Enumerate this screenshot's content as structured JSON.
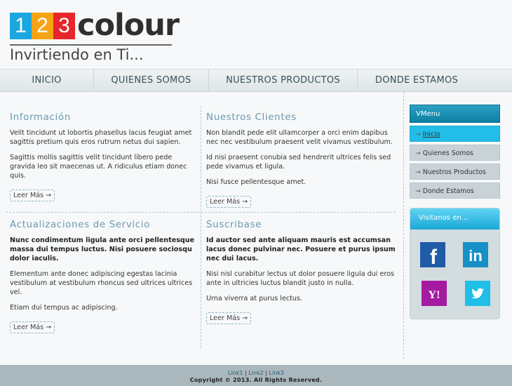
{
  "logo": {
    "digits": [
      "1",
      "2",
      "3"
    ],
    "word": "colour",
    "tagline": "Invirtiendo en Ti...",
    "colors": {
      "d1": "#1aa7e0",
      "d2": "#f7a414",
      "d3": "#e7262b"
    }
  },
  "nav": {
    "items": [
      {
        "label": "INICIO"
      },
      {
        "label": "QUIENES SOMOS"
      },
      {
        "label": "NUESTROS PRODUCTOS"
      },
      {
        "label": "DONDE ESTAMOS"
      }
    ]
  },
  "sections": [
    {
      "title": "Información",
      "paragraphs": [
        "Velit tincidunt ut lobortis phasellus lacus feugiat amet sagittis pretium quis eros rutrum netus dui sapien.",
        "Sagittis mollis sagittis velit tincidunt libero pede gravida leo sit maecenas ut. A ridiculus etiam donec quis."
      ],
      "more": "Leer Más →"
    },
    {
      "title": "Nuestros Clientes",
      "paragraphs": [
        "Non blandit pede elit ullamcorper a orci enim dapibus nec nec vestibulum praesent velit vivamus vestibulum.",
        "Id nisi praesent conubia sed hendrerit ultrices felis sed pede vivamus et ligula.",
        "Nisi fusce pellentesque amet."
      ],
      "more": "Leer Más →"
    },
    {
      "title": "Actualizaciones de Servicio",
      "lead": "Nunc condimentum ligula ante orci pellentesque massa dui tempus luctus. Nisi posuere sociosqu dolor iaculis.",
      "paragraphs": [
        "Elementum ante donec adipiscing egestas lacinia vestibulum at vestibulum rhoncus sed ultrices ultrices vel.",
        "Etiam dui tempus ac adipiscing."
      ],
      "more": "Leer Más →"
    },
    {
      "title": "Suscribase",
      "lead": "Id auctor sed ante aliquam mauris est accumsan lacus donec pulvinar nec. Posuere et purus ipsum nec dui lacus.",
      "paragraphs": [
        "Nisi nisl curabitur lectus ut dolor posuere ligula dui eros ante in ultricies luctus blandit justo in nulla.",
        "Urna viverra at purus lectus."
      ],
      "more": "Leer Más →"
    }
  ],
  "vmenu": {
    "title": "VMenu",
    "arrow": "→",
    "items": [
      {
        "label": "Inicio",
        "active": true
      },
      {
        "label": "Quienes Somos",
        "active": false
      },
      {
        "label": "Nuestros Productos",
        "active": false
      },
      {
        "label": "Donde Estamos",
        "active": false
      }
    ]
  },
  "visit": {
    "title": "Visitanos en...",
    "icons": [
      "facebook-icon",
      "linkedin-icon",
      "yahoo-icon",
      "twitter-icon"
    ],
    "glyphs": {
      "facebook": "f",
      "linkedin": "in",
      "yahoo": "Y!"
    }
  },
  "footer": {
    "links": [
      "Link1",
      "Link2",
      "Link3"
    ],
    "separator": "|",
    "copyright": "Copyright © 2013. All Rights Reserved."
  }
}
